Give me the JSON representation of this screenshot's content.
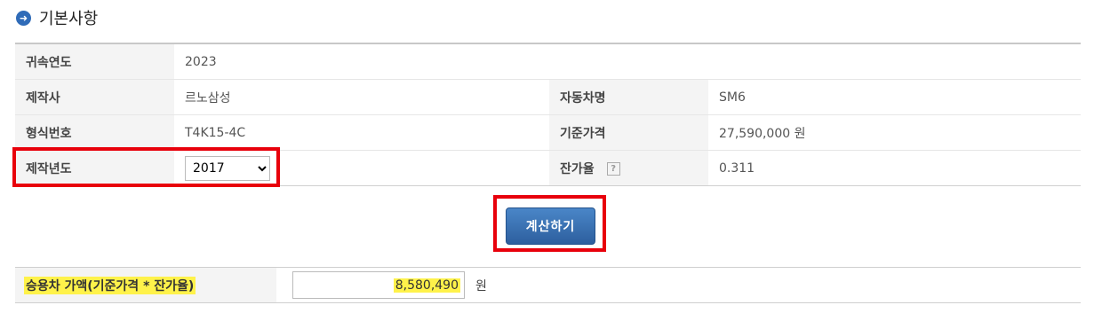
{
  "section": {
    "title": "기본사항"
  },
  "info": {
    "year_label": "귀속연도",
    "year_value": "2023",
    "maker_label": "제작사",
    "maker_value": "르노삼성",
    "car_label": "자동차명",
    "car_value": "SM6",
    "model_label": "형식번호",
    "model_value": "T4K15-4C",
    "base_price_label": "기준가격",
    "base_price_value": "27,590,000 원",
    "made_year_label": "제작년도",
    "made_year_value": "2017",
    "residual_label": "잔가율",
    "residual_help": "?",
    "residual_value": "0.311"
  },
  "actions": {
    "calc_label": "계산하기"
  },
  "result": {
    "label": "승용차 가액(기준가격 * 잔가율)",
    "value": "8,580,490",
    "unit": "원"
  },
  "colors": {
    "accent": "#2f6bb8",
    "highlight": "#fff24a",
    "annotation": "#e8000b"
  }
}
